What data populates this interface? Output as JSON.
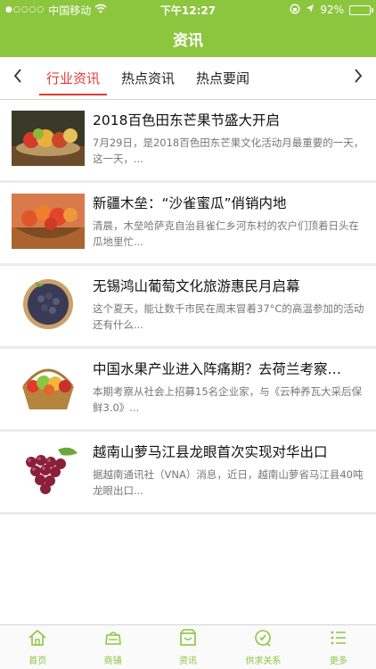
{
  "status": {
    "carrier": "中国移动",
    "time": "下午12:27",
    "battery": "92%",
    "battery_level": 0.92,
    "signal_icon": "signal-dots-icon",
    "wifi_icon": "wifi-icon"
  },
  "header": {
    "title": "资讯"
  },
  "tabs": {
    "items": [
      {
        "label": "行业资讯"
      },
      {
        "label": "热点资讯"
      },
      {
        "label": "热点要闻"
      }
    ],
    "active": "行业资讯"
  },
  "articles": [
    {
      "title": "2018百色田东芒果节盛大开启",
      "desc": "7月29日，是2018百色田东芒果文化活动月最重要的一天，这一天，..."
    },
    {
      "title": "新疆木垒：“沙雀蜜瓜”俏销内地",
      "desc": "清晨，木垒哈萨克自治县雀仁乡河东村的农户们顶着日头在瓜地里忙..."
    },
    {
      "title": "无锡鸿山葡萄文化旅游惠民月启幕",
      "desc": "这个夏天，能让数千市民在周末冒着37°C的高温参加的活动还有什么..."
    },
    {
      "title": "中国水果产业进入阵痛期？去荷兰考察…",
      "desc": "本期考察从社会上招募15名企业家，与《云种养瓦大采后保鲜3.0》..."
    },
    {
      "title": "越南山萝马江县龙眼首次实现对华出口",
      "desc": "据越南通讯社（VNA）消息，近日，越南山萝省马江县40吨龙眼出口..."
    }
  ],
  "bottom_nav": [
    {
      "label": "首页",
      "icon": "home-icon"
    },
    {
      "label": "商铺",
      "icon": "shop-icon"
    },
    {
      "label": "资讯",
      "icon": "news-icon"
    },
    {
      "label": "供求关系",
      "icon": "supply-icon"
    },
    {
      "label": "更多",
      "icon": "more-icon"
    }
  ],
  "colors": {
    "accent": "#8cc63f",
    "active_tab": "#e53935"
  }
}
